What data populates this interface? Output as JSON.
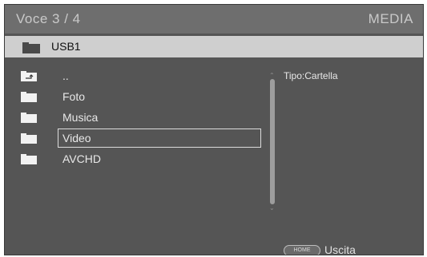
{
  "header": {
    "item_counter": "Voce 3 / 4",
    "mode_label": "MEDIA"
  },
  "path": {
    "current_folder": "USB1",
    "icon": "folder-icon"
  },
  "file_list": [
    {
      "name": "..",
      "icon": "parent-folder-icon",
      "selected": false
    },
    {
      "name": "Foto",
      "icon": "folder-icon",
      "selected": false
    },
    {
      "name": "Musica",
      "icon": "folder-icon",
      "selected": false
    },
    {
      "name": "Video",
      "icon": "folder-icon",
      "selected": true
    },
    {
      "name": "AVCHD",
      "icon": "folder-icon",
      "selected": false
    }
  ],
  "scrollbar": {
    "up_icon": "scroll-up-arrow-icon",
    "down_icon": "scroll-down-arrow-icon"
  },
  "info": {
    "type_label": "Tipo:Cartella"
  },
  "footer": {
    "home_button_label": "HOME",
    "exit_label": "Uscita"
  },
  "colors": {
    "background": "#555555",
    "title_bar": "#6e6e6e",
    "path_bar": "#cfcfcf",
    "text": "#e8e8e8",
    "selection_border": "#dcdcdc"
  }
}
